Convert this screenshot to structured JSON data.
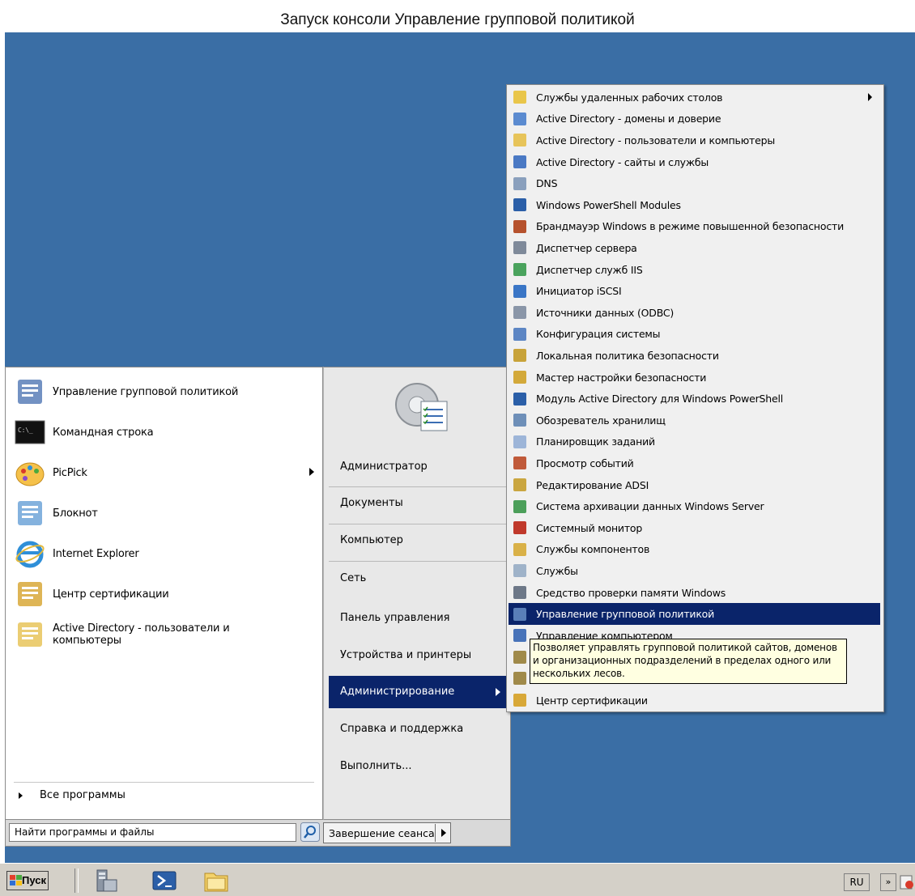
{
  "caption": "Запуск консоли Управление групповой политикой",
  "start_menu": {
    "programs": [
      {
        "label": "Управление групповой политикой",
        "icon": "group-policy-icon"
      },
      {
        "label": "Командная строка",
        "icon": "cmd-icon"
      },
      {
        "label": "PicPick",
        "icon": "picpick-icon",
        "has_submenu": true
      },
      {
        "label": "Блокнот",
        "icon": "notepad-icon"
      },
      {
        "label": "Internet Explorer",
        "icon": "ie-icon"
      },
      {
        "label": "Центр сертификации",
        "icon": "certificate-icon"
      },
      {
        "label": "Active Directory - пользователи и компьютеры",
        "icon": "ad-users-icon"
      }
    ],
    "all_programs": "Все программы",
    "search_placeholder": "Найти программы и файлы",
    "right_links": [
      {
        "label": "Администратор"
      },
      {
        "label": "Документы"
      },
      {
        "label": "Компьютер"
      },
      {
        "label": "Сеть"
      },
      {
        "label": "Панель управления"
      },
      {
        "label": "Устройства и принтеры"
      },
      {
        "label": "Администрирование",
        "selected": true,
        "has_submenu": true
      },
      {
        "label": "Справка и поддержка"
      },
      {
        "label": "Выполнить..."
      }
    ],
    "logout": "Завершение сеанса"
  },
  "admin_submenu": {
    "items": [
      {
        "label": "Службы удаленных рабочих столов",
        "icon": "folder-icon",
        "has_submenu": true
      },
      {
        "label": "Active Directory - домены и доверие",
        "icon": "ad-domains-icon"
      },
      {
        "label": "Active Directory - пользователи и компьютеры",
        "icon": "ad-users-icon"
      },
      {
        "label": "Active Directory - сайты и службы",
        "icon": "ad-sites-icon"
      },
      {
        "label": "DNS",
        "icon": "dns-icon"
      },
      {
        "label": "Windows PowerShell Modules",
        "icon": "powershell-icon"
      },
      {
        "label": "Брандмауэр Windows в режиме повышенной безопасности",
        "icon": "firewall-icon"
      },
      {
        "label": "Диспетчер сервера",
        "icon": "server-manager-icon"
      },
      {
        "label": "Диспетчер служб IIS",
        "icon": "iis-icon"
      },
      {
        "label": "Инициатор iSCSI",
        "icon": "iscsi-icon"
      },
      {
        "label": "Источники данных (ODBC)",
        "icon": "odbc-icon"
      },
      {
        "label": "Конфигурация системы",
        "icon": "sysconfig-icon"
      },
      {
        "label": "Локальная политика безопасности",
        "icon": "local-policy-icon"
      },
      {
        "label": "Мастер настройки безопасности",
        "icon": "security-wizard-icon"
      },
      {
        "label": "Модуль Active Directory для Windows PowerShell",
        "icon": "ad-powershell-icon"
      },
      {
        "label": "Обозреватель хранилищ",
        "icon": "storage-explorer-icon"
      },
      {
        "label": "Планировщик заданий",
        "icon": "task-scheduler-icon"
      },
      {
        "label": "Просмотр событий",
        "icon": "event-viewer-icon"
      },
      {
        "label": "Редактирование ADSI",
        "icon": "adsi-icon"
      },
      {
        "label": "Система архивации данных Windows Server",
        "icon": "backup-icon"
      },
      {
        "label": "Системный монитор",
        "icon": "perfmon-icon"
      },
      {
        "label": "Службы компонентов",
        "icon": "component-services-icon"
      },
      {
        "label": "Службы",
        "icon": "services-icon"
      },
      {
        "label": "Средство проверки памяти Windows",
        "icon": "memory-check-icon"
      },
      {
        "label": "Управление групповой политикой",
        "icon": "group-policy-icon",
        "highlighted": true
      },
      {
        "label": "Управление компьютером",
        "icon": "computer-management-icon"
      },
      {
        "label": "",
        "icon": "generic-tool-icon"
      },
      {
        "label": "",
        "icon": "generic-tool-icon"
      },
      {
        "label": "Центр сертификации",
        "icon": "certificate-icon"
      }
    ],
    "tooltip": "Позволяет управлять групповой политикой сайтов, доменов и организационных подразделений в пределах одного или нескольких лесов."
  },
  "taskbar": {
    "start_label": "Пуск",
    "pinned": [
      "server-manager-icon",
      "powershell-icon",
      "explorer-icon"
    ],
    "lang": "RU",
    "expand_glyph": "»"
  },
  "colors": {
    "desktop": "#3a6ea5",
    "selection": "#0a246a",
    "tooltip_bg": "#ffffe1"
  }
}
